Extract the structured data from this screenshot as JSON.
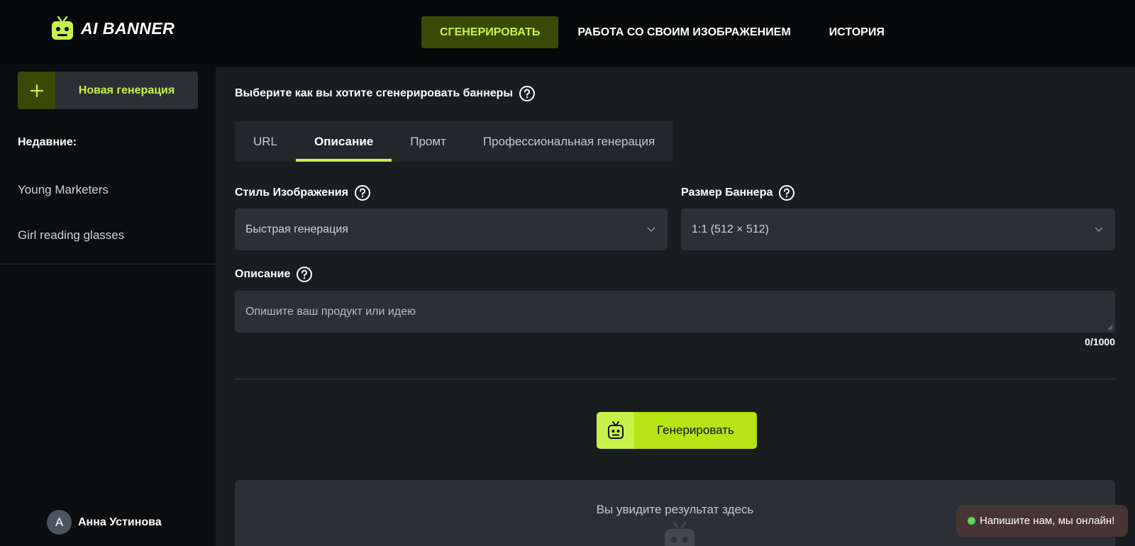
{
  "brand": {
    "name": "AI BANNER",
    "accent": "#c6f24a",
    "accent_dark": "#3a4a06"
  },
  "nav": [
    {
      "label": "СГЕНЕРИРОВАТЬ",
      "active": true
    },
    {
      "label": "РАБОТА СО СВОИМ ИЗОБРАЖЕНИЕМ",
      "active": false
    },
    {
      "label": "ИСТОРИЯ",
      "active": false
    }
  ],
  "sidebar": {
    "new_generation_label": "Новая генерация",
    "recent_title": "Недавние:",
    "recent_items": [
      "Young Marketers",
      "Girl reading glasses"
    ],
    "user": {
      "initial": "А",
      "name": "Анна Устинова"
    }
  },
  "main": {
    "title": "Выберите как вы хотите сгенерировать баннеры",
    "tabs": [
      {
        "label": "URL",
        "active": false
      },
      {
        "label": "Описание",
        "active": true
      },
      {
        "label": "Промт",
        "active": false
      },
      {
        "label": "Профессиональная генерация",
        "active": false
      }
    ],
    "style": {
      "label": "Стиль Изображения",
      "value": "Быстрая генерация"
    },
    "size": {
      "label": "Размер Баннера",
      "value": "1:1 (512 × 512)"
    },
    "description": {
      "label": "Описание",
      "placeholder": "Опишите ваш продукт или идею",
      "counter": "0/1000"
    },
    "generate_label": "Генерировать",
    "result_text": "Вы увидите результат здесь"
  },
  "chat": {
    "label": "Напишите нам, мы онлайн!",
    "status_color": "#5cd65c"
  },
  "icons": {
    "logo": "robot-icon",
    "plus": "plus-icon",
    "help": "question-icon",
    "chevron": "chevron-down-icon",
    "generate": "robot-icon"
  }
}
